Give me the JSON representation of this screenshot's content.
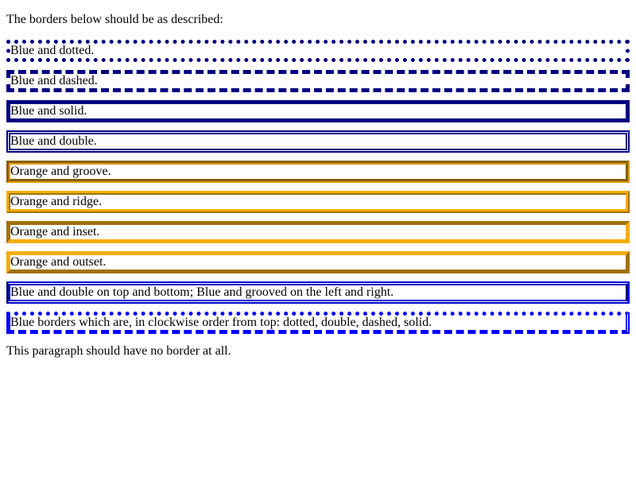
{
  "intro_text": "The borders below should be as described:",
  "boxes": [
    {
      "label": "Blue and dotted.",
      "color": "#000080",
      "style": "dotted"
    },
    {
      "label": "Blue and dashed.",
      "color": "#000080",
      "style": "dashed"
    },
    {
      "label": "Blue and solid.",
      "color": "#000080",
      "style": "solid"
    },
    {
      "label": "Blue and double.",
      "color": "#000080",
      "style": "double"
    },
    {
      "label": "Orange and groove.",
      "color": "#dc9a00",
      "style": "groove"
    },
    {
      "label": "Orange and ridge.",
      "color": "#f5ad0a",
      "style": "ridge"
    },
    {
      "label": "Orange and inset.",
      "color": "#f5ad0a",
      "style": "inset"
    },
    {
      "label": "Orange and outset.",
      "color": "#f5ad0a",
      "style": "outset"
    },
    {
      "label": "Blue and double on top and bottom; Blue and grooved on the left and right.",
      "color": "#0000cc",
      "style": "double groove"
    },
    {
      "label": "Blue borders which are, in clockwise order from top: dotted, double, dashed, solid.",
      "color": "#0000ff",
      "style": "dotted double dashed solid"
    }
  ],
  "outro_text": "This paragraph should have no border at all."
}
